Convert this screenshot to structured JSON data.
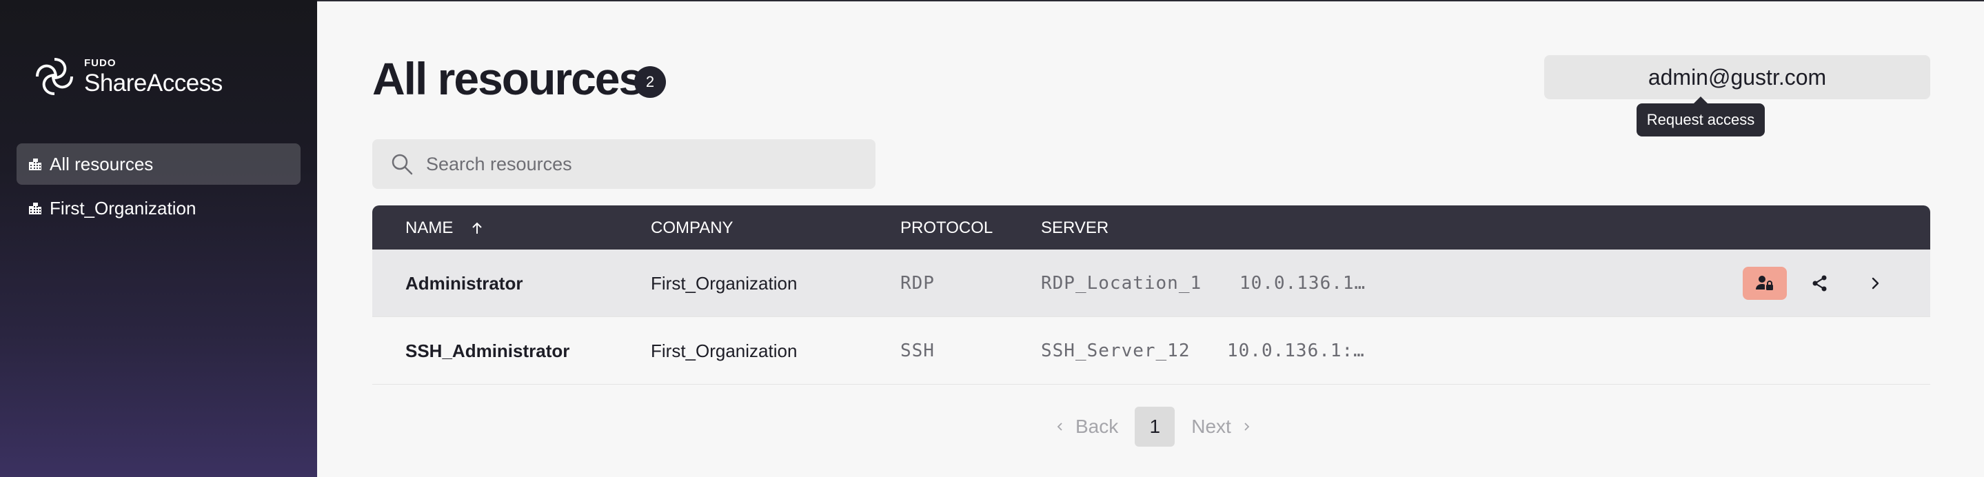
{
  "brand": {
    "sup": "FUDO",
    "name": "ShareAccess"
  },
  "sidebar": {
    "items": [
      {
        "label": "All resources",
        "icon": "building-icon",
        "active": true
      },
      {
        "label": "First_Organization",
        "icon": "building-icon",
        "active": false
      }
    ]
  },
  "header": {
    "title": "All resources",
    "count": "2",
    "user": "admin@gustr.com"
  },
  "search": {
    "placeholder": "Search resources",
    "value": ""
  },
  "table": {
    "columns": {
      "name": "NAME",
      "company": "COMPANY",
      "protocol": "PROTOCOL",
      "server": "SERVER"
    },
    "rows": [
      {
        "name": "Administrator",
        "company": "First_Organization",
        "protocol": "RDP",
        "server": "RDP_Location_1",
        "address": "10.0.136.1…"
      },
      {
        "name": "SSH_Administrator",
        "company": "First_Organization",
        "protocol": "SSH",
        "server": "SSH_Server_12",
        "address": "10.0.136.1:…"
      }
    ],
    "tooltip": "Request access"
  },
  "pager": {
    "back": "Back",
    "current": "1",
    "next": "Next"
  },
  "colors": {
    "accent": "#f2a494",
    "header": "#34333f",
    "sidebar_bottom": "#3b3160"
  }
}
